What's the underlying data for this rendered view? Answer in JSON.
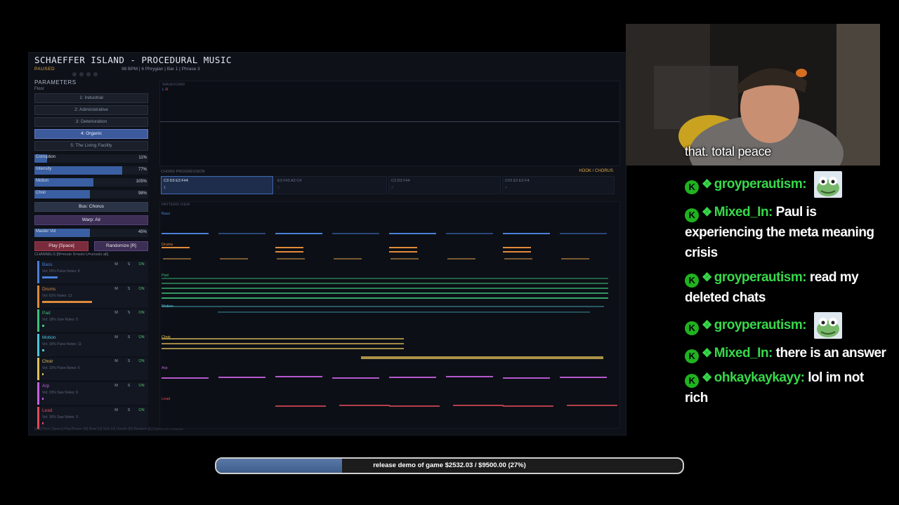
{
  "app": {
    "title": "SCHAEFFER ISLAND - PROCEDURAL MUSIC",
    "status": "PAUSED",
    "meta": "98 BPM  |  6 Phrygian  |  Bar 1  |  Phrase 3",
    "params_heading": "PARAMETERS",
    "floor_heading": "Floor",
    "floors": [
      "1: Industrial",
      "2: Administrative",
      "3: Deterioration",
      "4: Organic",
      "5: The Living Facility"
    ],
    "active_floor_index": 3,
    "sliders": [
      {
        "label": "Corruption",
        "value": "11%",
        "level": 0.11
      },
      {
        "label": "Intensity",
        "value": "77%",
        "level": 0.77
      },
      {
        "label": "Motion",
        "value": "105%",
        "level": 0.52
      },
      {
        "label": "Choir",
        "value": "98%",
        "level": 0.49
      }
    ],
    "bus_chorus": "Bus: Chorus",
    "warp_air": "Warp: Air",
    "master_vol": {
      "label": "Master Vol",
      "value": "45%",
      "level": 0.49
    },
    "play_label": "Play [Space]",
    "randomize_label": "Randomize [R]",
    "channels_hint": "CHANNELS  [M=mute  S=solo  U=unsolo all]",
    "channels": [
      {
        "name": "Bass",
        "info": "Vol: 55%  Pulse  Notes: 8",
        "color": "#4a7fd8",
        "m": "M",
        "s": "S",
        "on": "ON",
        "level": 0.14
      },
      {
        "name": "Drums",
        "info": "Vol: 61%  Notes: 13",
        "color": "#e08a3a",
        "m": "M",
        "s": "S",
        "on": "ON",
        "level": 0.45
      },
      {
        "name": "Pad",
        "info": "Vol: 18%  Sine  Notes: 5",
        "color": "#3fc07a",
        "m": "M",
        "s": "S",
        "on": "ON",
        "level": 0.02
      },
      {
        "name": "Motion",
        "info": "Vol: 16%  Pulse  Notes: 11",
        "color": "#4fc6d8",
        "m": "M",
        "s": "S",
        "on": "ON",
        "level": 0.02
      },
      {
        "name": "Choir",
        "info": "Vol: 10%  Pulse  Notes: 6",
        "color": "#e0c05a",
        "m": "M",
        "s": "S",
        "on": "ON",
        "level": 0.01
      },
      {
        "name": "Arp",
        "info": "Vol: 23%  Saw  Notes: 8",
        "color": "#c860e0",
        "m": "M",
        "s": "S",
        "on": "ON",
        "level": 0.01
      },
      {
        "name": "Lead",
        "info": "Vol: 10%  Saw  Notes: 3",
        "color": "#e04a5a",
        "m": "M",
        "s": "S",
        "on": "ON",
        "level": 0.01
      }
    ],
    "footer": "[1-5] Floor  [Space] Play/Pause  [M] Mute  [S] Solo  [U] Unsolo  [R] Random  [E] Export  [+/-] Volume",
    "waveform_label": "WAVEFORM",
    "waveform_lr": "L R",
    "chord_label": "CHORD PROGRESSION",
    "chord_hook": "HOOK / CHORUS",
    "chords": [
      {
        "notes": "C3 D3 E3 F#4",
        "num": "1",
        "active": true
      },
      {
        "notes": "E3 F#3 A3 C4",
        "num": "2",
        "active": false
      },
      {
        "notes": "C3 D3 F#4",
        "num": "3",
        "active": false
      },
      {
        "notes": "C#3 E3 E3 F4",
        "num": "4",
        "active": false
      }
    ],
    "pattern_label": "PATTERN VIEW",
    "tracks": [
      "Bass",
      "Drums",
      "Pad",
      "Motion",
      "Choir",
      "Arp",
      "Lead"
    ]
  },
  "stream": {
    "caption": "that. total peace",
    "chat": [
      {
        "user": "groyperautism:",
        "text": "",
        "emote": true
      },
      {
        "user": "Mixed_In:",
        "text": "Paul is experiencing the meta meaning crisis",
        "emote": false
      },
      {
        "user": "groyperautism:",
        "text": "read my deleted chats",
        "emote": false
      },
      {
        "user": "groyperautism:",
        "text": "",
        "emote": true
      },
      {
        "user": "Mixed_In:",
        "text": "there is an answer",
        "emote": false
      },
      {
        "user": "ohkaykaykayy:",
        "text": "lol im not rich",
        "emote": false
      }
    ],
    "goal_text": "release demo of game $2532.03 / $9500.00 (27%)",
    "goal_fraction": 0.27
  },
  "colors": {
    "accent": "#3c5a9c",
    "warning": "#e0a94a",
    "chat_user": "#38d84a"
  }
}
